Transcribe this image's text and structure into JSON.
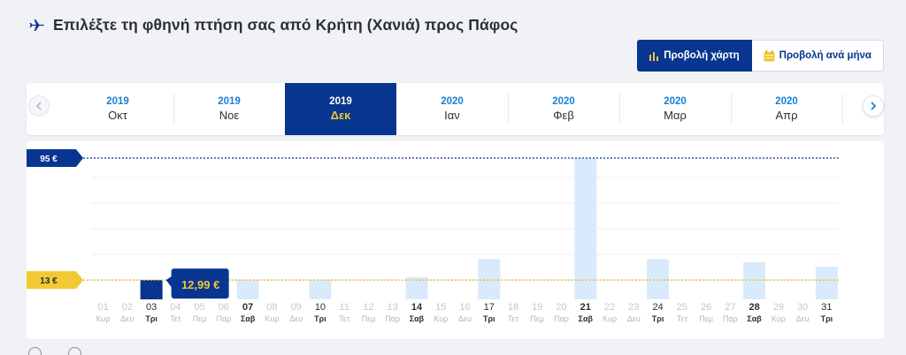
{
  "header": {
    "title": "Επιλέξτε τη φθηνή πτήση σας από Κρήτη (Χανιά) προς Πάφος",
    "icon": "plane-icon"
  },
  "view_toggle": {
    "chart_label": "Προβολή χάρτη",
    "month_label": "Προβολή ανά μήνα"
  },
  "months": [
    {
      "year": "2019",
      "name": "Οκτ",
      "selected": false
    },
    {
      "year": "2019",
      "name": "Νοε",
      "selected": false
    },
    {
      "year": "2019",
      "name": "Δεκ",
      "selected": true
    },
    {
      "year": "2020",
      "name": "Ιαν",
      "selected": false
    },
    {
      "year": "2020",
      "name": "Φεβ",
      "selected": false
    },
    {
      "year": "2020",
      "name": "Μαρ",
      "selected": false
    },
    {
      "year": "2020",
      "name": "Απρ",
      "selected": false
    }
  ],
  "colors": {
    "brand": "#073590",
    "accent": "#f1c933",
    "bar": "#d9eafc",
    "bar_selected": "#073590",
    "muted": "#b8bcc6"
  },
  "chart_data": {
    "type": "bar",
    "ylim": [
      0,
      95
    ],
    "reference_lines": [
      {
        "label": "95 €",
        "value": 95,
        "style": "max"
      },
      {
        "label": "13 €",
        "value": 13,
        "style": "min"
      }
    ],
    "tooltip": {
      "label": "12,99 €",
      "day": "03"
    },
    "days": [
      {
        "day": "01",
        "weekday": "Κυρ",
        "value": null,
        "bold": false
      },
      {
        "day": "02",
        "weekday": "Δευ",
        "value": null,
        "bold": false
      },
      {
        "day": "03",
        "weekday": "Τρι",
        "value": 12.99,
        "bold": true,
        "selected": true
      },
      {
        "day": "04",
        "weekday": "Τετ",
        "value": null,
        "bold": false
      },
      {
        "day": "05",
        "weekday": "Πεμ",
        "value": null,
        "bold": false
      },
      {
        "day": "06",
        "weekday": "Παρ",
        "value": null,
        "bold": false
      },
      {
        "day": "07",
        "weekday": "Σαβ",
        "value": 12.99,
        "bold": true
      },
      {
        "day": "08",
        "weekday": "Κυρ",
        "value": null,
        "bold": false
      },
      {
        "day": "09",
        "weekday": "Δευ",
        "value": null,
        "bold": false
      },
      {
        "day": "10",
        "weekday": "Τρι",
        "value": 12.99,
        "bold": true
      },
      {
        "day": "11",
        "weekday": "Τετ",
        "value": null,
        "bold": false
      },
      {
        "day": "12",
        "weekday": "Πεμ",
        "value": null,
        "bold": false
      },
      {
        "day": "13",
        "weekday": "Παρ",
        "value": null,
        "bold": false
      },
      {
        "day": "14",
        "weekday": "Σαβ",
        "value": 15,
        "bold": true
      },
      {
        "day": "15",
        "weekday": "Κυρ",
        "value": null,
        "bold": false
      },
      {
        "day": "16",
        "weekday": "Δευ",
        "value": null,
        "bold": false
      },
      {
        "day": "17",
        "weekday": "Τρι",
        "value": 27,
        "bold": true
      },
      {
        "day": "18",
        "weekday": "Τετ",
        "value": null,
        "bold": false
      },
      {
        "day": "19",
        "weekday": "Πεμ",
        "value": null,
        "bold": false
      },
      {
        "day": "20",
        "weekday": "Παρ",
        "value": null,
        "bold": false
      },
      {
        "day": "21",
        "weekday": "Σαβ",
        "value": 95,
        "bold": true
      },
      {
        "day": "22",
        "weekday": "Κυρ",
        "value": null,
        "bold": false
      },
      {
        "day": "23",
        "weekday": "Δευ",
        "value": null,
        "bold": false
      },
      {
        "day": "24",
        "weekday": "Τρι",
        "value": 27,
        "bold": true
      },
      {
        "day": "25",
        "weekday": "Τετ",
        "value": null,
        "bold": false
      },
      {
        "day": "26",
        "weekday": "Πεμ",
        "value": null,
        "bold": false
      },
      {
        "day": "27",
        "weekday": "Παρ",
        "value": null,
        "bold": false
      },
      {
        "day": "28",
        "weekday": "Σαβ",
        "value": 25,
        "bold": true
      },
      {
        "day": "29",
        "weekday": "Κυρ",
        "value": null,
        "bold": false
      },
      {
        "day": "30",
        "weekday": "Δευ",
        "value": null,
        "bold": false
      },
      {
        "day": "31",
        "weekday": "Τρι",
        "value": 22,
        "bold": true
      }
    ]
  }
}
